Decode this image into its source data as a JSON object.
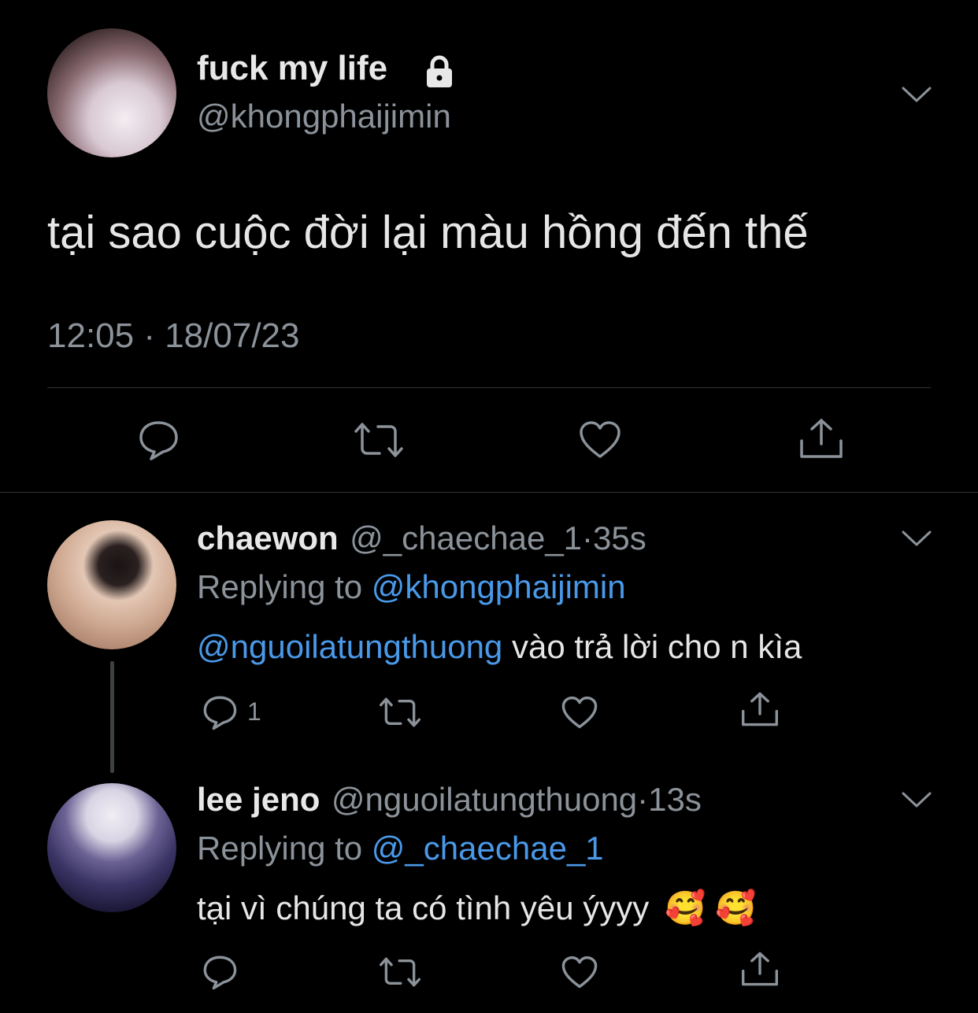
{
  "tweet": {
    "display_name": "fuck my life",
    "handle": "@khongphaijimin",
    "text": "tại sao cuộc đời lại màu hồng đến thế",
    "timestamp": "12:05 · 18/07/23",
    "icons": [
      "lock-icon",
      "chevron-down-icon",
      "reply-icon",
      "retweet-icon",
      "like-icon",
      "share-icon"
    ]
  },
  "replies": [
    {
      "display_name": "chaewon",
      "handle_time": "@_chaechae_1·35s",
      "replying_prefix": "Replying to ",
      "replying_to": "@khongphaijimin",
      "mention": "@nguoilatungthuong",
      "text": " vào trả lời cho n kìa",
      "reply_count": "1"
    },
    {
      "display_name": "lee jeno",
      "handle_time": "@nguoilatungthuong·13s",
      "replying_prefix": "Replying to ",
      "replying_to": "@_chaechae_1",
      "text": "tại vì chúng ta có tình yêu ýyyy",
      "emoji": "🥰 🥰"
    }
  ],
  "colors": {
    "background": "#000000",
    "link": "#4a99e9",
    "secondary_text": "#8b9299",
    "divider": "#2f3336"
  }
}
